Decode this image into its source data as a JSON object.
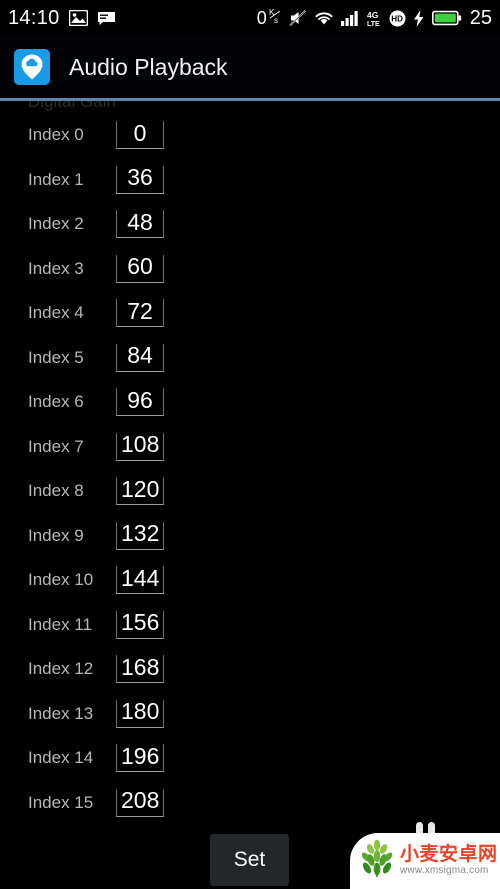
{
  "statusbar": {
    "clock": "14:10",
    "icons_left": [
      "photo-icon",
      "message-icon"
    ],
    "network_speed": "0",
    "network_speed_unit_num": "K",
    "network_speed_unit_den": "s",
    "icons_right": [
      "mute-icon",
      "wifi-icon",
      "signal-bars-icon",
      "4g-lte-icon",
      "hd-icon",
      "charging-bolt-icon",
      "battery-icon"
    ],
    "lte_top": "4G",
    "lte_bottom": "LTE",
    "hd_label": "HD",
    "battery_percent": "25",
    "battery_color": "#3ecf3e"
  },
  "appbar": {
    "icon_name": "cloud-pin-icon",
    "icon_bg": "#1b9ae6",
    "title": "Audio Playback",
    "rule_color": "#5a86ad"
  },
  "content": {
    "section_title": "Digital Gain",
    "rows": [
      {
        "label": "Index 0",
        "value": "0"
      },
      {
        "label": "Index 1",
        "value": "36"
      },
      {
        "label": "Index 2",
        "value": "48"
      },
      {
        "label": "Index 3",
        "value": "60"
      },
      {
        "label": "Index 4",
        "value": "72"
      },
      {
        "label": "Index 5",
        "value": "84"
      },
      {
        "label": "Index 6",
        "value": "96"
      },
      {
        "label": "Index 7",
        "value": "108"
      },
      {
        "label": "Index 8",
        "value": "120"
      },
      {
        "label": "Index 9",
        "value": "132"
      },
      {
        "label": "Index 10",
        "value": "144"
      },
      {
        "label": "Index 11",
        "value": "156"
      },
      {
        "label": "Index 12",
        "value": "168"
      },
      {
        "label": "Index 13",
        "value": "180"
      },
      {
        "label": "Index 14",
        "value": "196"
      },
      {
        "label": "Index 15",
        "value": "208"
      }
    ]
  },
  "footer": {
    "set_label": "Set"
  },
  "watermark": {
    "logo_name": "wheat-logo-icon",
    "site_name": "小麦安卓网",
    "site_url": "www.xmsigma.com",
    "text_color": "#e8432a"
  }
}
